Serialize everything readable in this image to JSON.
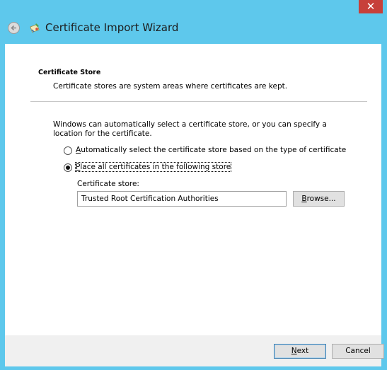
{
  "window": {
    "close_glyph": "✕"
  },
  "header": {
    "title": "Certificate Import Wizard",
    "back_icon": "back-arrow-icon",
    "app_icon": "certificate-wizard-icon"
  },
  "page": {
    "section_title": "Certificate Store",
    "section_description": "Certificate stores are system areas where certificates are kept.",
    "intro_text": "Windows can automatically select a certificate store, or you can specify a location for the certificate."
  },
  "options": [
    {
      "accel": "A",
      "rest": "utomatically select the certificate store based on the type of certificate",
      "checked": false
    },
    {
      "accel": "P",
      "rest": "lace all certificates in the following store",
      "checked": true
    }
  ],
  "store": {
    "label": "Certificate store:",
    "value": "Trusted Root Certification Authorities",
    "browse_accel": "B",
    "browse_rest": "rowse..."
  },
  "footer": {
    "next_accel": "N",
    "next_rest": "ext",
    "cancel_label": "Cancel"
  }
}
